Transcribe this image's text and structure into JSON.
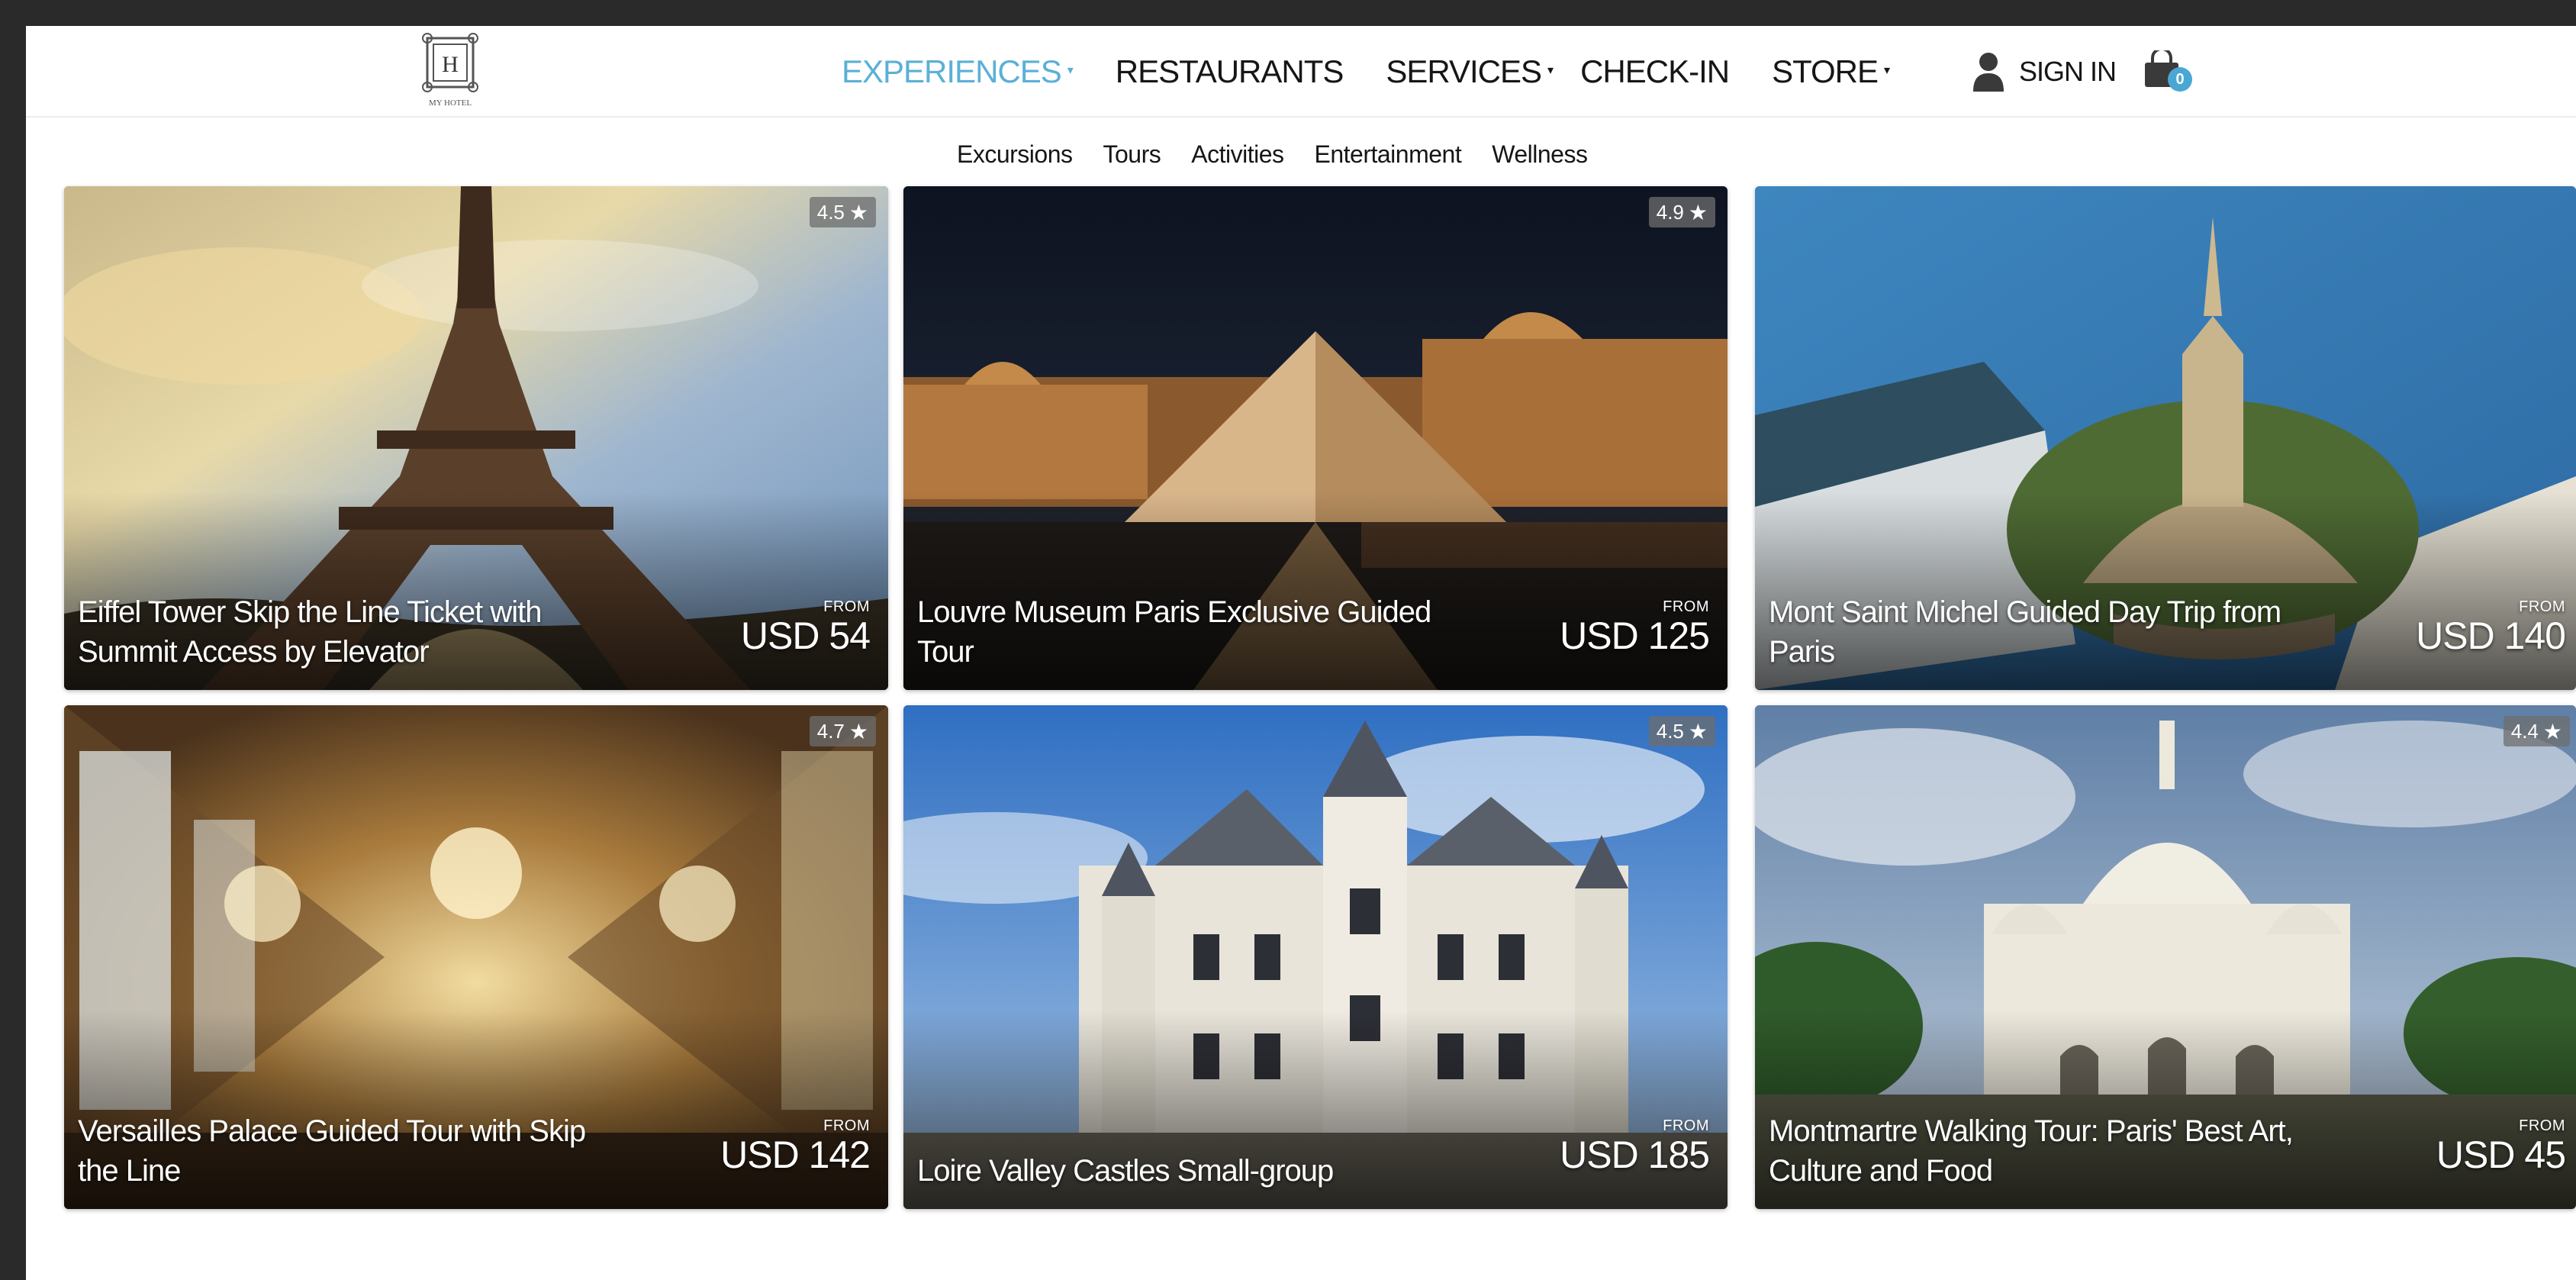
{
  "header": {
    "logo_letter": "H",
    "logo_caption": "MY HOTEL",
    "nav": [
      {
        "label": "EXPERIENCES",
        "dropdown": true,
        "active": true
      },
      {
        "label": "RESTAURANTS",
        "dropdown": false,
        "active": false
      },
      {
        "label": "SERVICES",
        "dropdown": true,
        "active": false
      },
      {
        "label": "CHECK-IN",
        "dropdown": false,
        "active": false
      },
      {
        "label": "STORE",
        "dropdown": true,
        "active": false
      }
    ],
    "signin_label": "SIGN IN",
    "cart_count": "0",
    "accent_color": "#5bb0d6"
  },
  "subnav": [
    "Excursions",
    "Tours",
    "Activities",
    "Entertainment",
    "Wellness"
  ],
  "cards": [
    {
      "title": "Eiffel Tower Skip the Line Ticket with Summit Access by Elevator",
      "rating": "4.5",
      "from_label": "FROM",
      "price": "USD 54"
    },
    {
      "title": "Louvre Museum Paris Exclusive Guided Tour",
      "rating": "4.9",
      "from_label": "FROM",
      "price": "USD 125"
    },
    {
      "title": "Mont Saint Michel Guided Day Trip from Paris",
      "rating": "",
      "from_label": "FROM",
      "price": "USD 140"
    },
    {
      "title": "Versailles Palace Guided Tour with Skip the Line",
      "rating": "4.7",
      "from_label": "FROM",
      "price": "USD 142"
    },
    {
      "title": "Loire Valley Castles Small-group",
      "rating": "4.5",
      "from_label": "FROM",
      "price": "USD 185"
    },
    {
      "title": "Montmartre Walking Tour: Paris' Best Art, Culture and Food",
      "rating": "4.4",
      "from_label": "FROM",
      "price": "USD 45"
    }
  ],
  "icons": {
    "rating": "star-icon",
    "user": "user-icon",
    "cart": "shopping-bag-icon",
    "dropdown": "caret-down-icon"
  }
}
